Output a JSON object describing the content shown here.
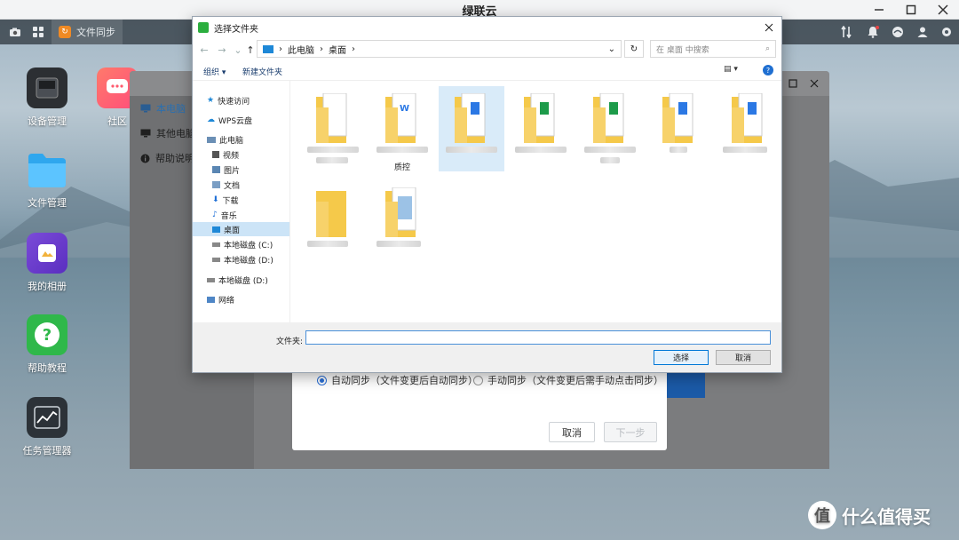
{
  "app": {
    "title": "绿联云"
  },
  "taskbar": {
    "active_app_label": "文件同步"
  },
  "desktop": {
    "icons": [
      {
        "label": "设备管理",
        "icon": "device-icon"
      },
      {
        "label": "社区",
        "icon": "community-icon"
      },
      {
        "label": "文件管理",
        "icon": "folder-icon"
      },
      {
        "label": "我的相册",
        "icon": "album-icon"
      },
      {
        "label": "帮助教程",
        "icon": "help-icon"
      },
      {
        "label": "任务管理器",
        "icon": "task-manager-icon"
      }
    ]
  },
  "sync_window": {
    "sidebar": [
      {
        "label": "本电脑",
        "icon": "monitor-icon"
      },
      {
        "label": "其他电脑",
        "icon": "computer-icon"
      },
      {
        "label": "帮助说明",
        "icon": "info-icon"
      }
    ]
  },
  "wizard": {
    "auto_sync": "自动同步（文件变更后自动同步）",
    "manual_sync": "手动同步（文件变更后需手动点击同步）",
    "cancel": "取消",
    "next": "下一步"
  },
  "dialog": {
    "title": "选择文件夹",
    "breadcrumb": [
      "此电脑",
      "桌面"
    ],
    "search_placeholder": "在 桌面 中搜索",
    "organize": "组织 ▾",
    "new_folder": "新建文件夹",
    "nav": {
      "quick_access": "快速访问",
      "wps_cloud": "WPS云盘",
      "this_pc": "此电脑",
      "videos": "视频",
      "pictures": "图片",
      "documents": "文档",
      "downloads": "下载",
      "music": "音乐",
      "desktop": "桌面",
      "disk_c": "本地磁盘 (C:)",
      "disk_d": "本地磁盘 (D:)",
      "disk_d2": "本地磁盘 (D:)",
      "network": "网络"
    },
    "files": [
      {
        "type": "doc",
        "caption": ""
      },
      {
        "type": "word",
        "caption": "质控"
      },
      {
        "type": "word",
        "caption": ""
      },
      {
        "type": "excel",
        "caption": ""
      },
      {
        "type": "excel",
        "caption": ""
      },
      {
        "type": "word",
        "caption": ""
      },
      {
        "type": "word",
        "caption": ""
      },
      {
        "type": "plain",
        "caption": ""
      },
      {
        "type": "doc",
        "caption": ""
      }
    ],
    "folder_label": "文件夹:",
    "folder_value": "",
    "select_button": "选择",
    "cancel_button": "取消"
  },
  "watermark": {
    "text": "什么值得买",
    "symbol": "值"
  }
}
